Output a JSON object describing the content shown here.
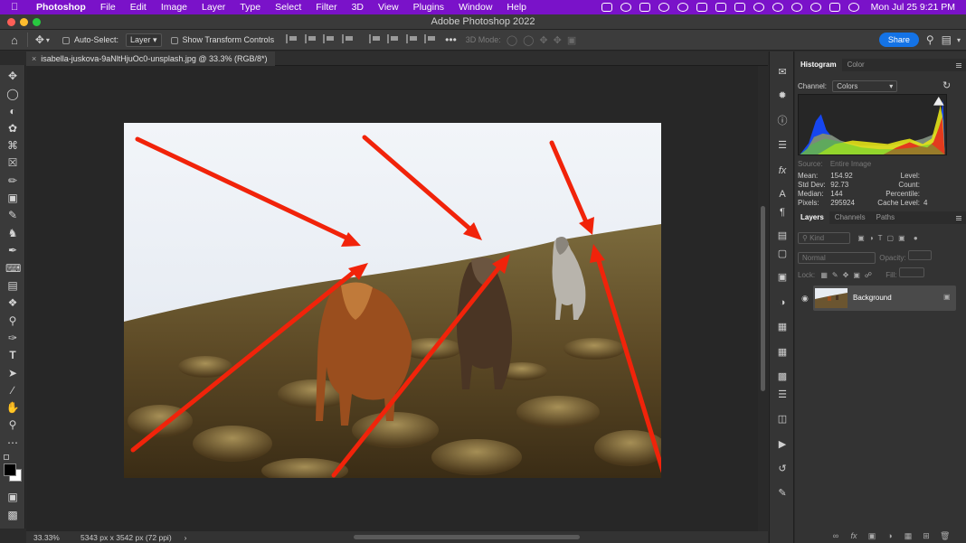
{
  "menubar": {
    "app": "Photoshop",
    "items": [
      "File",
      "Edit",
      "Image",
      "Layer",
      "Type",
      "Select",
      "Filter",
      "3D",
      "View",
      "Plugins",
      "Window",
      "Help"
    ],
    "clock": "Mon Jul 25  9:21 PM"
  },
  "window": {
    "title": "Adobe Photoshop 2022"
  },
  "options": {
    "auto_select_label": "Auto-Select:",
    "auto_select_value": "Layer",
    "transform_label": "Show Transform Controls",
    "mode_3d_label": "3D Mode:",
    "share_label": "Share"
  },
  "document": {
    "tab_title": "isabella-juskova-9aNltHjuOc0-unsplash.jpg @ 33.3% (RGB/8*)",
    "zoom": "33.33%",
    "dimensions": "5343 px x 3542 px (72 ppi)"
  },
  "histogram_panel": {
    "tabs": [
      "Histogram",
      "Color"
    ],
    "channel_label": "Channel:",
    "channel_value": "Colors",
    "source_label": "Source:",
    "source_value": "Entire Image",
    "stats_left": [
      {
        "label": "Mean:",
        "value": "154.92"
      },
      {
        "label": "Std Dev:",
        "value": "92.73"
      },
      {
        "label": "Median:",
        "value": "144"
      },
      {
        "label": "Pixels:",
        "value": "295924"
      }
    ],
    "stats_right": [
      {
        "label": "Level:",
        "value": ""
      },
      {
        "label": "Count:",
        "value": ""
      },
      {
        "label": "Percentile:",
        "value": ""
      },
      {
        "label": "Cache Level:",
        "value": "4"
      }
    ]
  },
  "layers_panel": {
    "tabs": [
      "Layers",
      "Channels",
      "Paths"
    ],
    "kind_placeholder": "Kind",
    "blend_mode": "Normal",
    "opacity_label": "Opacity:",
    "lock_label": "Lock:",
    "fill_label": "Fill:",
    "layers": [
      {
        "name": "Background"
      }
    ]
  },
  "colors": {
    "menubar": "#7a12c9",
    "accent": "#1473e6",
    "arrow": "#f1230a"
  }
}
